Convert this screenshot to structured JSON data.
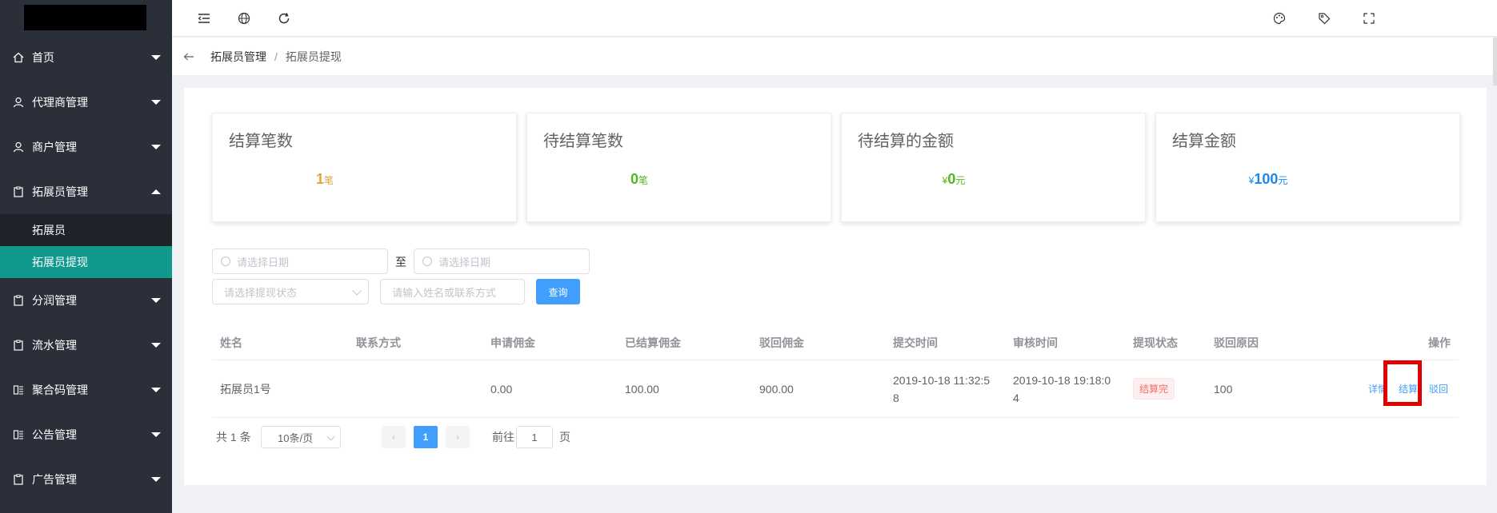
{
  "sidebar": {
    "items": [
      {
        "label": "首页",
        "icon": "home-icon"
      },
      {
        "label": "代理商管理",
        "icon": "user-icon"
      },
      {
        "label": "商户管理",
        "icon": "user-icon"
      },
      {
        "label": "拓展员管理",
        "icon": "clipboard-icon",
        "expanded": true
      },
      {
        "label": "分润管理",
        "icon": "clipboard-icon"
      },
      {
        "label": "流水管理",
        "icon": "clipboard-icon"
      },
      {
        "label": "聚合码管理",
        "icon": "qrcode-icon"
      },
      {
        "label": "公告管理",
        "icon": "qrcode-icon"
      },
      {
        "label": "广告管理",
        "icon": "clipboard-icon"
      }
    ],
    "sub_items": [
      {
        "label": "拓展员",
        "active": false
      },
      {
        "label": "拓展员提现",
        "active": true
      }
    ],
    "active_color": "#11998e"
  },
  "breadcrumb": {
    "parent": "拓展员管理",
    "separator": "/",
    "current": "拓展员提现"
  },
  "stats": [
    {
      "title": "结算笔数",
      "currency": "",
      "value": "1",
      "unit": "笔",
      "color": "#e6a23c"
    },
    {
      "title": "待结算笔数",
      "currency": "",
      "value": "0",
      "unit": "笔",
      "color": "#52b820"
    },
    {
      "title": "待结算的金额",
      "currency": "¥",
      "value": "0",
      "unit": "元",
      "color": "#52b820"
    },
    {
      "title": "结算金额",
      "currency": "¥",
      "value": "100",
      "unit": "元",
      "color": "#1e88e5"
    }
  ],
  "filters": {
    "start_date_placeholder": "请选择日期",
    "date_separator": "至",
    "end_date_placeholder": "请选择日期",
    "status_placeholder": "请选择提现状态",
    "keyword_placeholder": "请输入姓名或联系方式",
    "search_label": "查询"
  },
  "table": {
    "columns": [
      "姓名",
      "联系方式",
      "申请佣金",
      "已结算佣金",
      "驳回佣金",
      "提交时间",
      "审核时间",
      "提现状态",
      "驳回原因",
      "操作"
    ],
    "rows": [
      {
        "name": "拓展员1号",
        "contact": "",
        "apply": "0.00",
        "settled": "100.00",
        "rejected": "900.00",
        "submit_time_1": "2019-10-18 11:32:5",
        "submit_time_2": "8",
        "audit_time_1": "2019-10-18 19:18:0",
        "audit_time_2": "4",
        "status": "结算完",
        "reason": "100",
        "actions": {
          "detail": "详情",
          "settle": "结算",
          "reject": "驳回"
        }
      }
    ]
  },
  "pagination": {
    "total": "共 1 条",
    "page_size": "10条/页",
    "prev": "‹",
    "current_page": "1",
    "next": "›",
    "goto_label": "前往",
    "goto_value": "1",
    "page_word": "页"
  }
}
